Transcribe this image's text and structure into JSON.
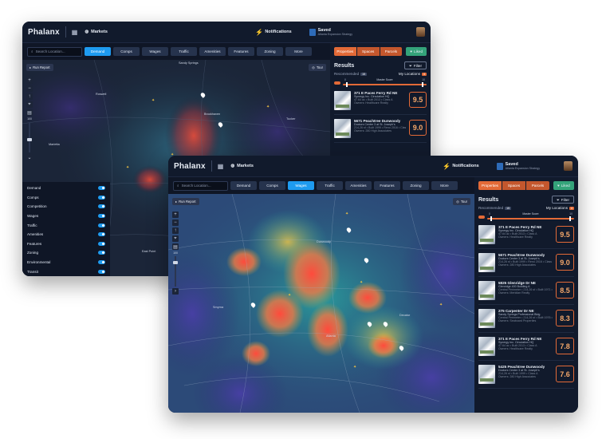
{
  "app": {
    "brand": "Phalanx",
    "markets_label": "Markets",
    "notifications_label": "Notifications",
    "saved_title": "Saved",
    "saved_subtitle": "Atlanta Expansion Strategy"
  },
  "search": {
    "placeholder": "Search Location..."
  },
  "filters": [
    "Demand",
    "Comps",
    "Wages",
    "Traffic",
    "Amenities",
    "Features",
    "Zoning",
    "More"
  ],
  "back_active_filter": "Demand",
  "front_active_filter": "Wages",
  "map_controls": {
    "run_report": "Run Report",
    "tour": "Tour",
    "zoom_value": "100"
  },
  "map_places": [
    "Sandy Springs",
    "Roswell",
    "Marietta",
    "Brookhaven",
    "Tucker",
    "Atlanta",
    "Decatur",
    "East Point",
    "Smyrna",
    "Dunwoody"
  ],
  "layers": [
    "Demand",
    "Comps",
    "Competition",
    "Wages",
    "Traffic",
    "Amenities",
    "Features",
    "Zoning",
    "Environmental",
    "Transit"
  ],
  "panel": {
    "tabs": [
      "Properties",
      "Spaces",
      "Parcels"
    ],
    "liked_label": "Liked",
    "results_title": "Results",
    "filter_label": "Filter",
    "recommended_label": "Recommended",
    "recommended_count": "15",
    "my_locations_label": "My Locations",
    "my_locations_count": "4",
    "master_score_label": "Master Score",
    "score_min": "0",
    "score_max": "10"
  },
  "properties": [
    {
      "name": "371 E Paces Ferry Rd NE",
      "subtitle": "Synergy Inc. Circulation HQ",
      "line1": "47.64 ac • Built 2013 • Class A",
      "line2": "Owners: Healthcare Realty",
      "score": "9.5"
    },
    {
      "name": "5671 Peachtree Dunwoody",
      "subtitle": "Doctors Center 3 at St. Joseph's",
      "line1": "214,26 sf • Built 1999 • Reno 2016 • Class A",
      "line2": "Owners: 280 High Associates",
      "score": "9.0"
    },
    {
      "name": "5825 Glenridge Dr NE",
      "subtitle": "Glenridge 400 Building A",
      "line1": "Central Perimeter • 214,26 sf • Built 1971 • Class A",
      "line2": "Owners: Meridian Realty",
      "score": "8.5"
    },
    {
      "name": "275 Carpenter Dr NE",
      "subtitle": "Sandy Springs Professional Bldg",
      "line1": "Central Perimeter • 214,26 sf • Built 1976 • Renov. 2014",
      "line2": "Owners: Seaboard Properties",
      "score": "8.3"
    },
    {
      "name": "371 E Paces Ferry Rd NE",
      "subtitle": "Synergy Inc. Circulation HQ",
      "line1": "47.64 ac • Built 2013 • Class A",
      "line2": "Owners: Healthcare Realty",
      "score": "7.8"
    },
    {
      "name": "5425 Peachtree Dunwoody",
      "subtitle": "Doctors Center 3 at St. Joseph's",
      "line1": "214,26 sf • Built 1999 • Class A",
      "line2": "Owners: 280 High Associates",
      "score": "7.6"
    }
  ],
  "colors": {
    "accent": "#1e9bf0",
    "orange": "#e36a37",
    "liked": "#34a37a",
    "bg": "#0f1626"
  },
  "icons": [
    "grid-icon",
    "globe-icon",
    "bolt-icon",
    "bookmark-icon",
    "search-icon",
    "heart-icon",
    "funnel-icon",
    "play-icon",
    "compass-icon",
    "layers-icon"
  ]
}
